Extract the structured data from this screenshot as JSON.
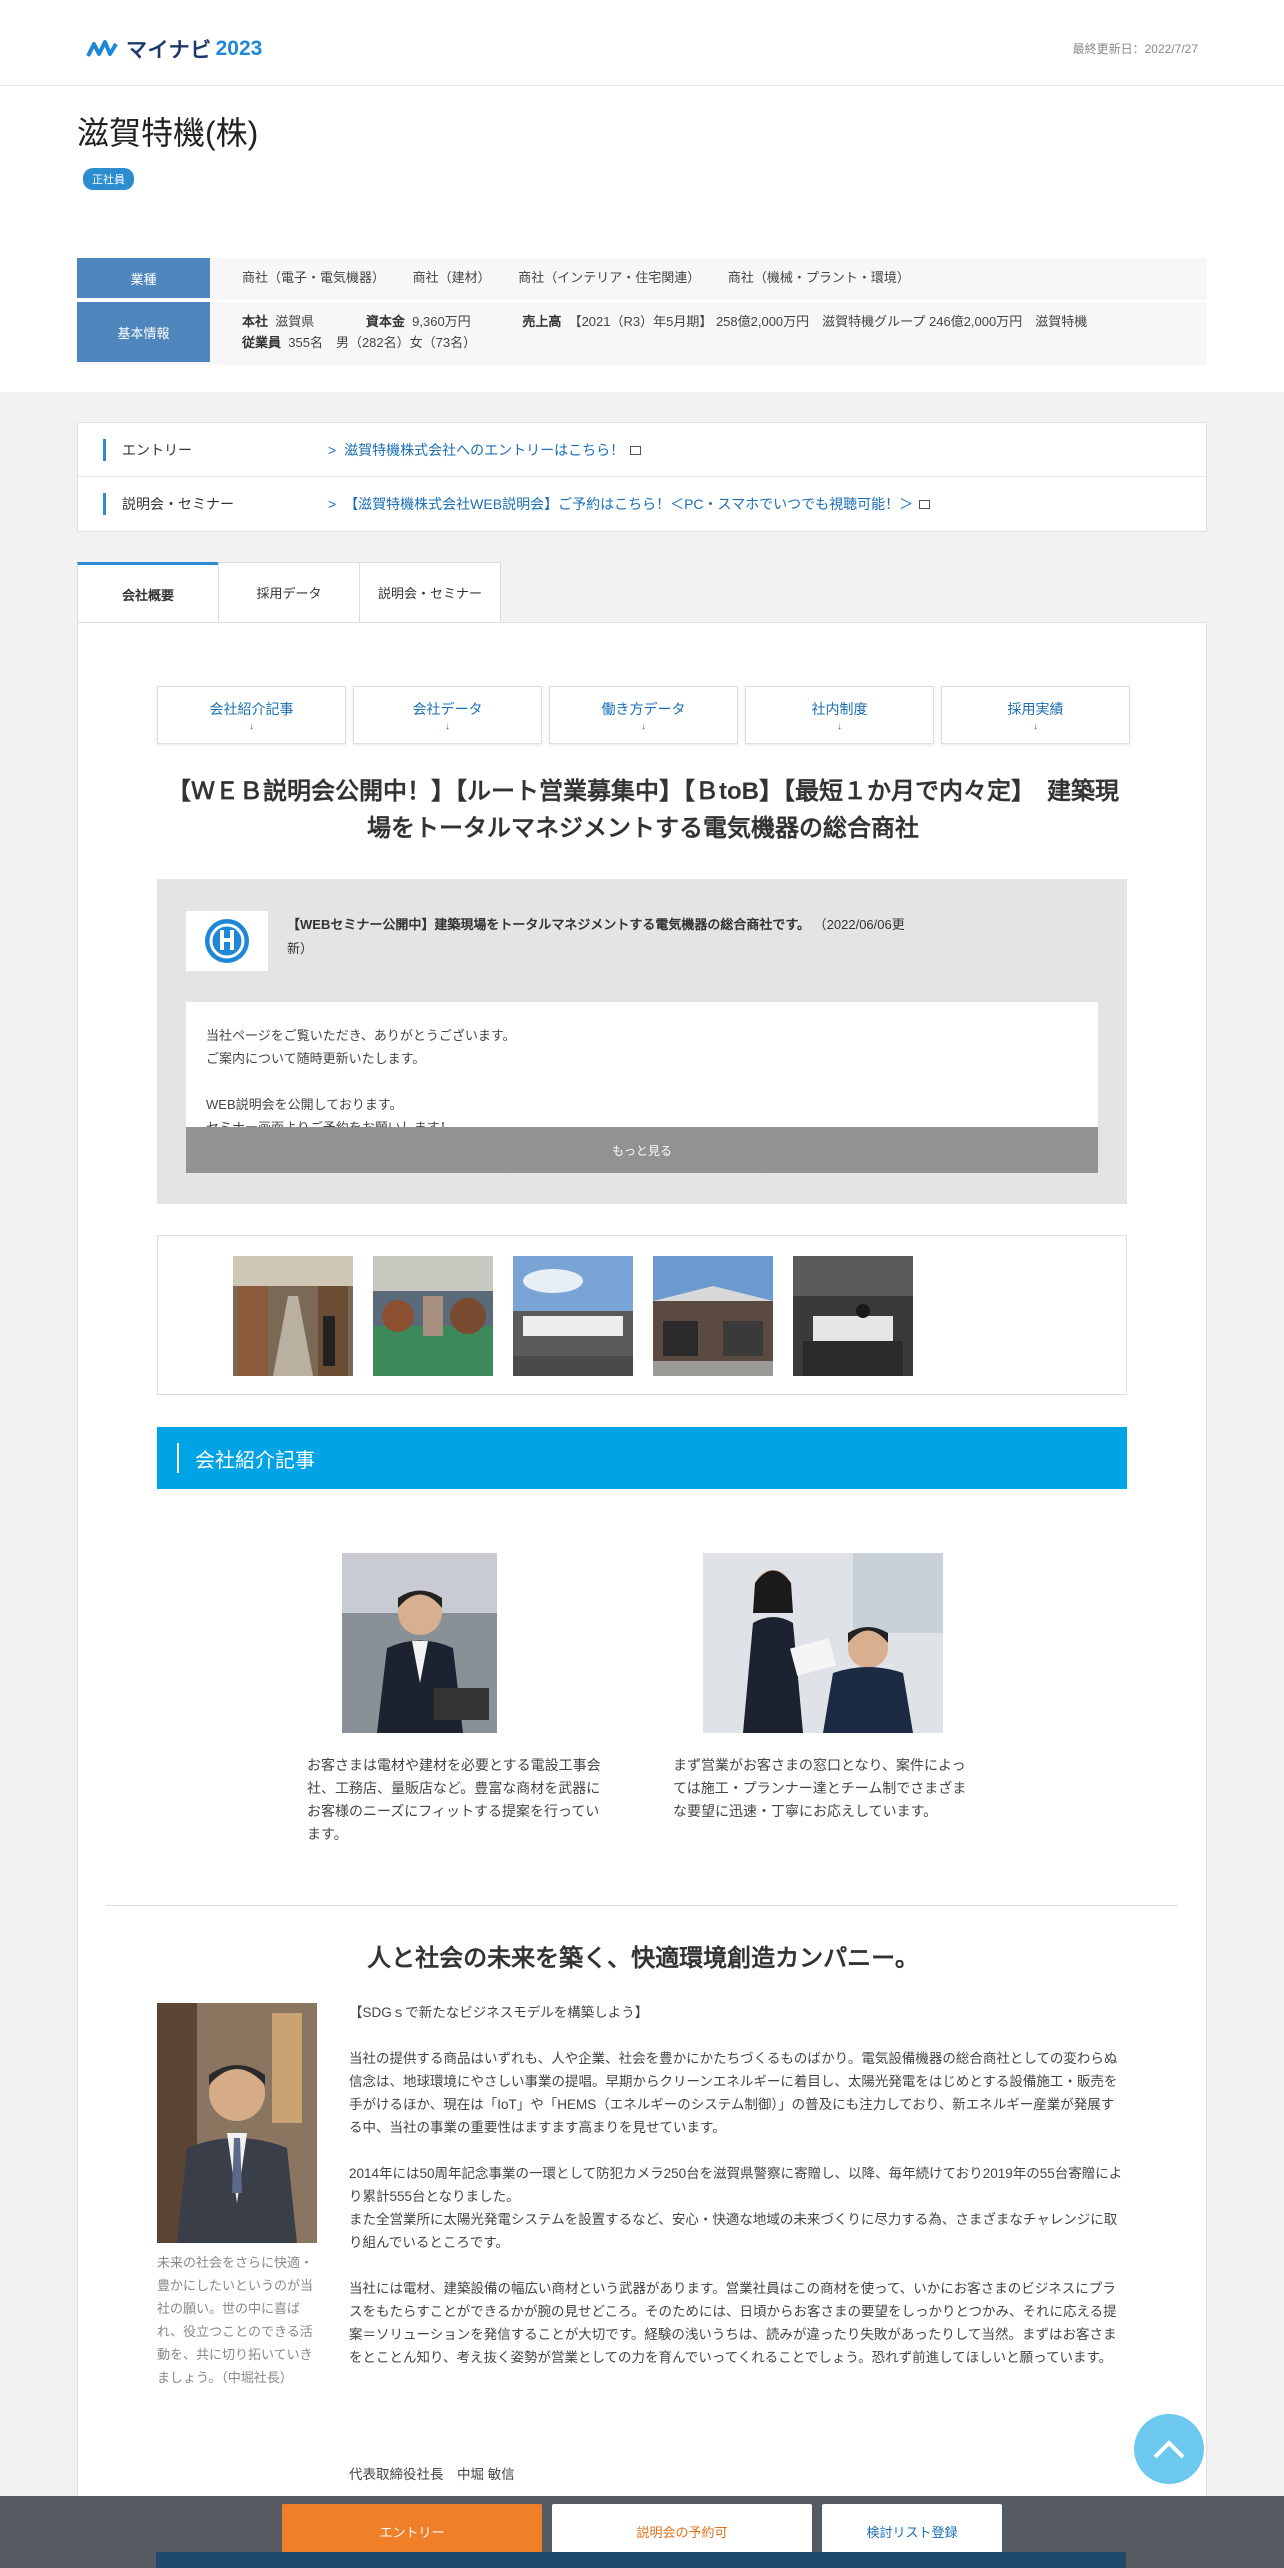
{
  "header": {
    "logo_text": "マイナビ",
    "logo_year": "2023",
    "updated": "最終更新日：2022/7/27"
  },
  "company": {
    "name": "滋賀特機(株)",
    "badge": "正社員"
  },
  "info": {
    "industry_label": "業種",
    "industries": [
      "商社（電子・電気機器）",
      "商社（建材）",
      "商社（インテリア・住宅関連）",
      "商社（機械・プラント・環境）"
    ],
    "basic_label": "基本情報",
    "hq_key": "本社",
    "hq_val": "滋賀県",
    "capital_key": "資本金",
    "capital_val": "9,360万円",
    "sales_key": "売上高",
    "sales_val": "【2021（R3）年5月期】 258億2,000万円　滋賀特機グループ 246億2,000万円　滋賀特機",
    "employees_key": "従業員",
    "employees_val": "355名　男（282名）女（73名）"
  },
  "links": [
    {
      "label": "エントリー",
      "target": "滋賀特機株式会社へのエントリーはこちら！"
    },
    {
      "label": "説明会・セミナー",
      "target": "【滋賀特機株式会社WEB説明会】ご予約はこちら！＜PC・スマホでいつでも視聴可能！＞"
    }
  ],
  "tabs": [
    "会社概要",
    "採用データ",
    "説明会・セミナー"
  ],
  "sub_nav": [
    "会社紹介記事",
    "会社データ",
    "働き方データ",
    "社内制度",
    "採用実績"
  ],
  "down_arrow": "↓",
  "headline": "【ＷＥＢ説明会公開中！】【ルート営業募集中】【ＢtoB】【最短１か月で内々定】　建築現場をトータルマネジメントする電気機器の総合商社",
  "pr": {
    "title_bold": "【WEBセミナー公開中】建築現場をトータルマネジメントする電気機器の総合商社です。",
    "title_date": "（2022/06/06更新）",
    "body_lines": [
      "当社ページをご覧いただき、ありがとうございます。",
      "ご案内について随時更新いたします。",
      "",
      "WEB説明会を公開しております。",
      "セミナー画面よりご予約をお願いします！"
    ],
    "more": "もっと見る"
  },
  "section_title": "会社紹介記事",
  "articles": [
    {
      "text": "お客さまは電材や建材を必要とする電設工事会社、工務店、量販店など。豊富な商材を武器にお客様のニーズにフィットする提案を行っています。"
    },
    {
      "text": "まず営業がお客さまの窓口となり、案件によっては施工・プランナー達とチーム制でさまざまな要望に迅速・丁寧にお応えしています。"
    }
  ],
  "sub_headline": "人と社会の未来を築く、快適環境創造カンパニー。",
  "president_caption": "未来の社会をさらに快適・豊かにしたいというのが当社の願い。世の中に喜ばれ、役立つことのできる活動を、共に切り拓いていきましょう。（中堀社長）",
  "body_paragraphs": [
    "【SDGｓで新たなビジネスモデルを構築しよう】",
    "当社の提供する商品はいずれも、人や企業、社会を豊かにかたちづくるものばかり。電気設備機器の総合商社としての変わらぬ信念は、地球環境にやさしい事業の提唱。早期からクリーンエネルギーに着目し、太陽光発電をはじめとする設備施工・販売を手がけるほか、現在は「IoT」や「HEMS（エネルギーのシステム制御）」の普及にも注力しており、新エネルギー産業が発展する中、当社の事業の重要性はますます高まりを見せています。",
    "2014年には50周年記念事業の一環として防犯カメラ250台を滋賀県警察に寄贈し、以降、毎年続けており2019年の55台寄贈により累計555台となりました。\nまた全営業所に太陽光発電システムを設置するなど、安心・快適な地域の未来づくりに尽力する為、さまざまなチャレンジに取り組んでいるところです。",
    "当社には電材、建築設備の幅広い商材という武器があります。営業社員はこの商材を使って、いかにお客さまのビジネスにプラスをもたらすことができるかが腕の見せどころ。そのためには、日頃からお客さまの要望をしっかりとつかみ、それに応える提案＝ソリューションを発信することが大切です。経験の浅いうちは、読みが違ったり失敗があったりして当然。まずはお客さまをとことん知り、考え抜く姿勢が営業としての力を育んでいってくれることでしょう。恐れず前進してほしいと願っています。"
  ],
  "signature": "代表取締役社長　中堀 敏信",
  "bottom_bar": {
    "entry": "エントリー",
    "seminar": "説明会の予約可",
    "list": "検討リスト登録"
  }
}
